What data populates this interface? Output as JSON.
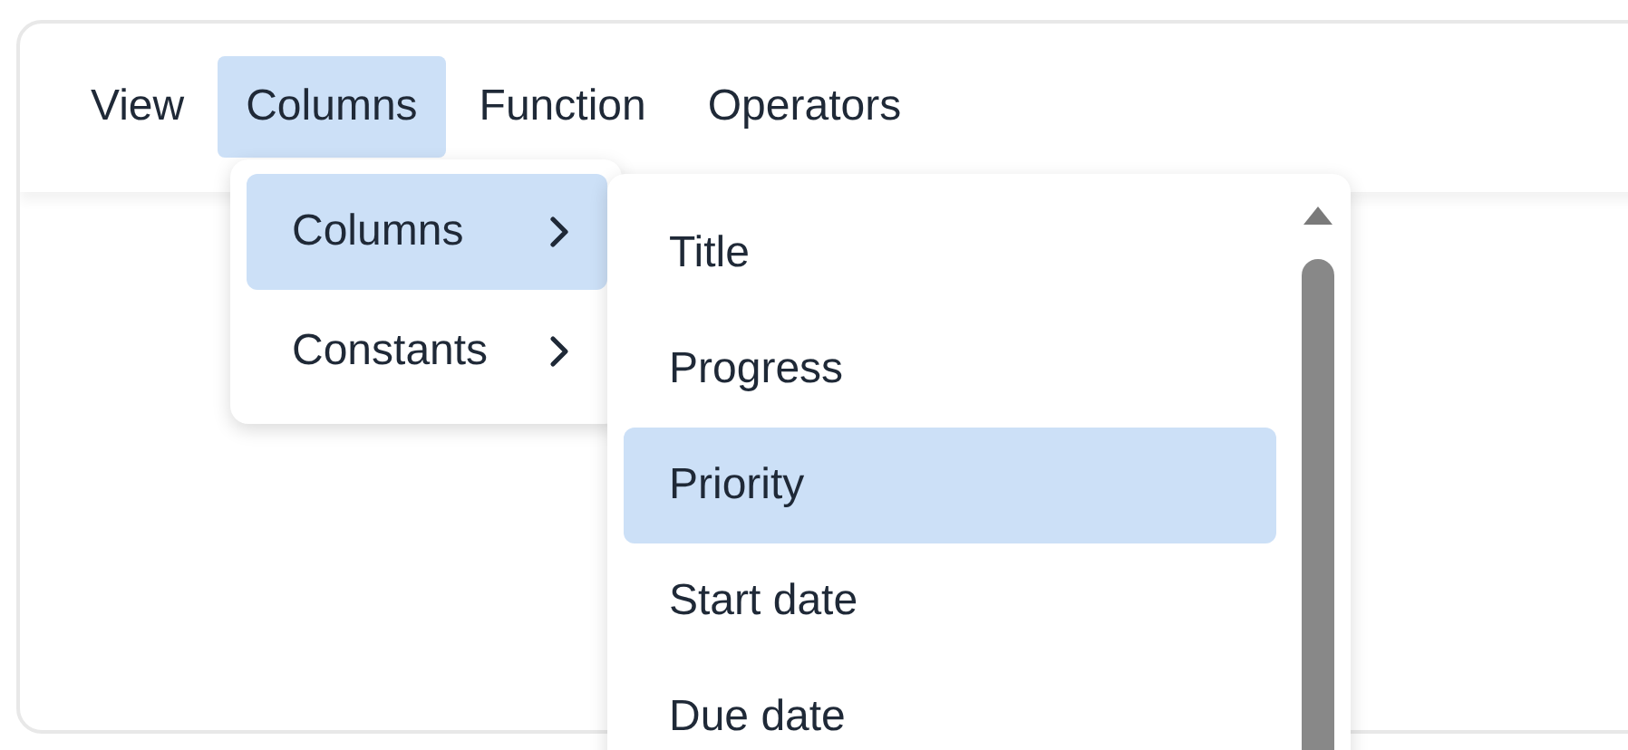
{
  "menubar": [
    {
      "label": "View",
      "selected": false
    },
    {
      "label": "Columns",
      "selected": true
    },
    {
      "label": "Function",
      "selected": false
    },
    {
      "label": "Operators",
      "selected": false
    }
  ],
  "submenu": [
    {
      "label": "Columns",
      "selected": true
    },
    {
      "label": "Constants",
      "selected": false
    }
  ],
  "column_list": [
    {
      "label": "Title",
      "selected": false
    },
    {
      "label": "Progress",
      "selected": false
    },
    {
      "label": "Priority",
      "selected": true
    },
    {
      "label": "Start date",
      "selected": false
    },
    {
      "label": "Due date",
      "selected": false
    }
  ]
}
